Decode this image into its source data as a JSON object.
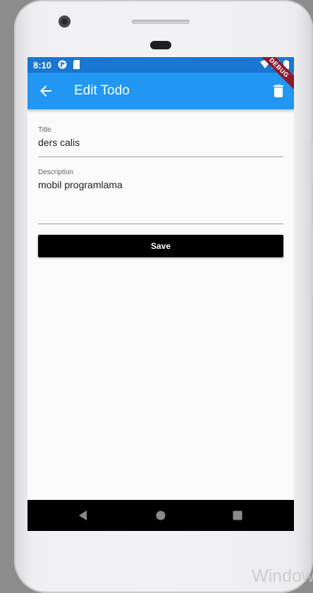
{
  "status_bar": {
    "time": "8:10"
  },
  "debug_banner": "DEBUG",
  "app_bar": {
    "title": "Edit Todo"
  },
  "form": {
    "title_label": "Title",
    "title_value": "ders calis",
    "description_label": "Description",
    "description_value": "mobil programlama",
    "save_label": "Save"
  },
  "watermark": "Window",
  "colors": {
    "app_bar": "#2196f3",
    "status_bar": "#1976d2",
    "save_button": "#000000"
  },
  "icons": [
    "back-arrow-icon",
    "trash-icon",
    "wifi-icon",
    "signal-icon",
    "battery-icon",
    "nav-back-icon",
    "nav-home-icon",
    "nav-recents-icon"
  ]
}
